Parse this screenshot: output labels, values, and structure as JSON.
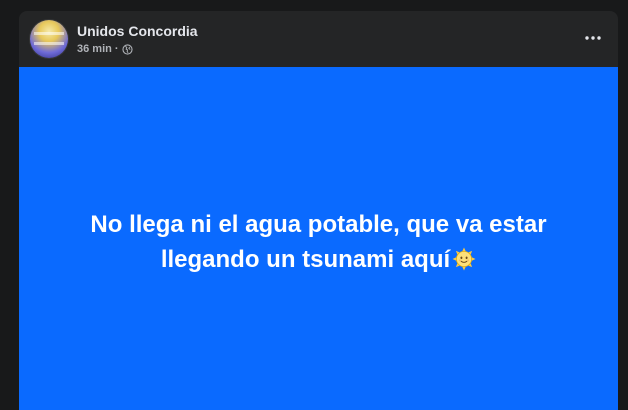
{
  "post": {
    "author": "Unidos Concordia",
    "time": "36 min",
    "separator": "·",
    "privacy_icon": "globe-icon",
    "menu_icon": "more-options-icon",
    "text": "No llega ni el agua potable, que va estar llegando un tsunami aquí",
    "emoji_icon": "sun-with-face-emoji",
    "background_color": "#0a6aff"
  }
}
